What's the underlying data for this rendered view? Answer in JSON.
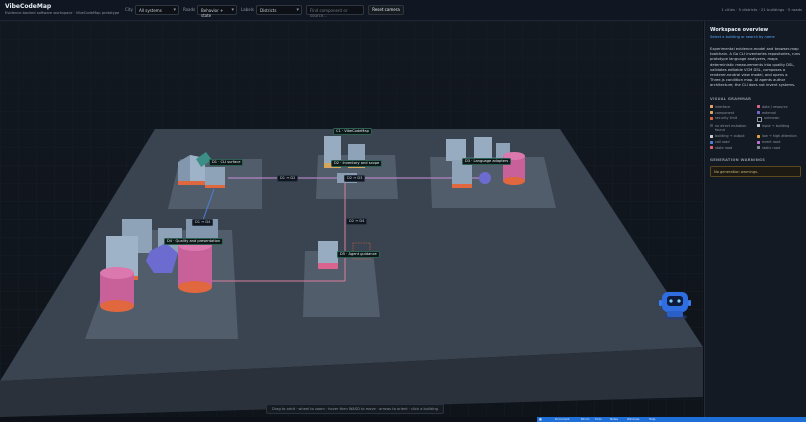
{
  "app": {
    "title": "VibeCodeMap",
    "subtitle": "Evidence-backed software workspace · VibeCodeMap prototype"
  },
  "controls": {
    "city_label": "City",
    "city_value": "All systems",
    "roads_label": "Roads",
    "roads_value": "Behavior + state",
    "labels_label": "Labels",
    "labels_value": "Districts",
    "search_placeholder": "Find component or source...",
    "reset_label": "Reset camera"
  },
  "stats": "1 cities · 5 districts · 21 buildings · 5 roads",
  "scene": {
    "city_label": "C1 · VibeCodeMap",
    "districts": [
      "D1 · CLI surface",
      "D2 · Inventory and scope",
      "D3 · Language adapters",
      "D4 · Quality and presentation",
      "D5 · Agent guidance"
    ],
    "roads": [
      "D1 ↔ D2",
      "D2 ↔ D3",
      "D2 ↔ D4",
      "D2 ↔ D5",
      "D1 ↔ D4"
    ],
    "hint": "Drag to orbit · wheel to zoom · hover then WASD to move · arrows to orient · click a building"
  },
  "panel": {
    "title": "Workspace overview",
    "subtitle": "Select a building or search by name",
    "description": "Experimental evidence-model and browser-map toolchain. A Go CLI inventories repositories, runs prototype language analyzers, maps deterministic measurements into quality DSL, validates editable VCM DSL, composes a renderer-neutral view model, and opens a Three.js condition map. AI agents author architecture; the CLI does not invent systems.",
    "grammar_heading": "VISUAL GRAMMAR",
    "grammar": [
      {
        "label": "interface",
        "color": "#e9a06a"
      },
      {
        "label": "data / resource",
        "color": "#d9658e"
      },
      {
        "label": "component",
        "color": "#d8a65a"
      },
      {
        "label": "external",
        "color": "#6c6cd0"
      },
      {
        "label": "security limit",
        "color": "#e0673e"
      },
      {
        "label": "unknown",
        "color": "#0d1117"
      },
      {
        "label": "no direct mutation found",
        "color": "#3d4553"
      },
      {
        "label": "input → building",
        "color": "#d0d0d0"
      },
      {
        "label": "building → output",
        "color": "#d0d0d0"
      },
      {
        "label": "low → high attention",
        "color": "#e0a040"
      },
      {
        "label": "call road",
        "color": "#4d7fd6"
      },
      {
        "label": "event road",
        "color": "#b96fd6"
      },
      {
        "label": "state road",
        "color": "#e0637c"
      },
      {
        "label": "static road",
        "color": "#8b8b8b"
      }
    ],
    "warnings_heading": "GENERATION WARNINGS",
    "warnings_text": "No generation warnings."
  },
  "taskbar": [
    "Document",
    "Minim",
    "Todo",
    "Notes",
    "Windows",
    "Help"
  ]
}
